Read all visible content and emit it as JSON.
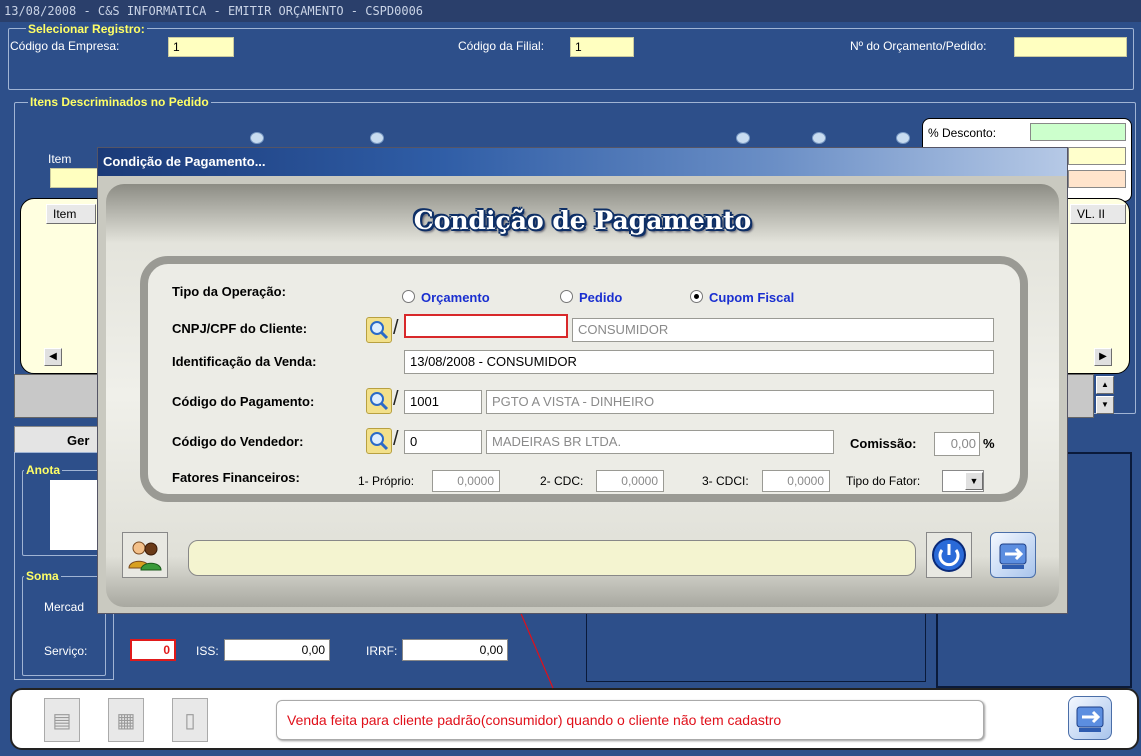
{
  "window": {
    "title": "13/08/2008 - C&S INFORMATICA - EMITIR ORÇAMENTO - CSPD0006"
  },
  "select_group": {
    "title": "Selecionar Registro:",
    "empresa_label": "Código da Empresa:",
    "empresa_value": "1",
    "filial_label": "Código da Filial:",
    "filial_value": "1",
    "orcamento_label": "Nº do Orçamento/Pedido:",
    "orcamento_value": ""
  },
  "items_group": {
    "title": "Itens Descriminados no Pedido",
    "item_label": "Item",
    "grid_item_header": "Item",
    "grid_vl_header": "VL. II",
    "desconto_label": "% Desconto:"
  },
  "bottom_left": {
    "tab_label": "Ger",
    "anot_label": "Anota",
    "soma_label": "Soma",
    "mercad_label": "Mercad",
    "servico_label": "Serviço:",
    "servico_value": "0",
    "iss_label": "ISS:",
    "iss_value": "0,00",
    "irrf_label": "IRRF:",
    "irrf_value": "0,00"
  },
  "dialog": {
    "title": "Condição de Pagamento...",
    "heading": "Condição de Pagamento",
    "tipo_label": "Tipo da Operação:",
    "options": [
      {
        "label": "Orçamento",
        "selected": false
      },
      {
        "label": "Pedido",
        "selected": false
      },
      {
        "label": "Cupom Fiscal",
        "selected": true
      }
    ],
    "cnpj_label": "CNPJ/CPF do Cliente:",
    "cnpj_value": "",
    "cliente_name": "CONSUMIDOR",
    "ident_label": "Identificação da Venda:",
    "ident_value": "13/08/2008 - CONSUMIDOR",
    "pagto_label": "Código do Pagamento:",
    "pagto_code": "1001",
    "pagto_desc": "PGTO A VISTA - DINHEIRO",
    "vend_label": "Código do Vendedor:",
    "vend_code": "0",
    "vend_desc": "MADEIRAS BR LTDA.",
    "comissao_label": "Comissão:",
    "comissao_value": "0,00",
    "comissao_unit": "%",
    "fatores_label": "Fatores Financeiros:",
    "proprio_label": "1- Próprio:",
    "proprio_value": "0,0000",
    "cdc_label": "2- CDC:",
    "cdc_value": "0,0000",
    "cdci_label": "3- CDCI:",
    "cdci_value": "0,0000",
    "tipo_fator_label": "Tipo do Fator:",
    "status_value": ""
  },
  "annotation": {
    "text": "Venda feita para cliente padrão(consumidor) quando o cliente não tem cadastro"
  },
  "icons": [
    "search-icon",
    "users-icon",
    "power-icon",
    "exit-icon",
    "disk-icon",
    "document-icon",
    "door-icon"
  ],
  "colors": {
    "background": "#2d4f8a",
    "field_yellow": "#ffffc0",
    "accent_blue": "#1a2fd0",
    "annotation_red": "#e0101a"
  }
}
